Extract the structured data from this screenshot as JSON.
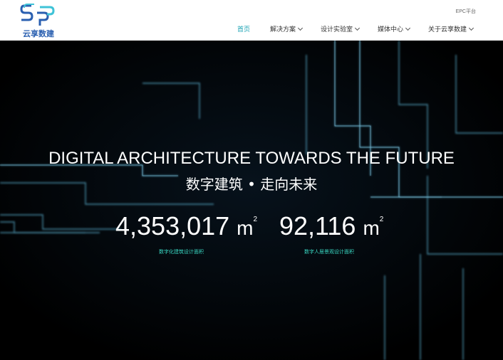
{
  "brand": {
    "name": "云享数建",
    "logo_icon": "ssp-logo-icon",
    "color": "#2a5fb0"
  },
  "topbar": {
    "epc_link": "EPC平台"
  },
  "nav": {
    "accent": "#19a2b3",
    "items": [
      {
        "label": "首页",
        "active": true,
        "dropdown": false
      },
      {
        "label": "解决方案",
        "active": false,
        "dropdown": true
      },
      {
        "label": "设计实验室",
        "active": false,
        "dropdown": true
      },
      {
        "label": "媒体中心",
        "active": false,
        "dropdown": true
      },
      {
        "label": "关于云享数建",
        "active": false,
        "dropdown": true
      }
    ]
  },
  "hero": {
    "title_en": "DIGITAL ARCHITECTURE TOWARDS THE FUTURE",
    "title_zh": "数字建筑 • 走向未来",
    "stats": [
      {
        "value": "4,353,017",
        "unit": "m",
        "unit_sup": "2",
        "label": "数字化建筑设计面积"
      },
      {
        "value": "92,116",
        "unit": "m",
        "unit_sup": "2",
        "label": "数字人居景观设计面积"
      }
    ],
    "label_color": "#39d7c2"
  }
}
